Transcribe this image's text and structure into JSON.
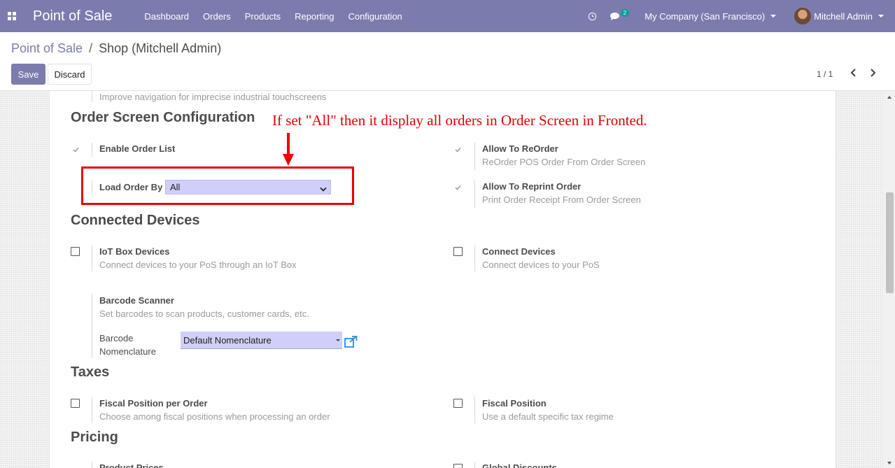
{
  "navbar": {
    "brand": "Point of Sale",
    "menu": [
      "Dashboard",
      "Orders",
      "Products",
      "Reporting",
      "Configuration"
    ],
    "chat_count": "2",
    "company": "My Company (San Francisco)",
    "user": "Mitchell Admin"
  },
  "breadcrumb": {
    "root": "Point of Sale",
    "separator": "/",
    "current": "Shop (Mitchell Admin)"
  },
  "buttons": {
    "save": "Save",
    "discard": "Discard"
  },
  "pager": {
    "value": "1 / 1"
  },
  "top_cut_help": "Improve navigation for imprecise industrial touchscreens",
  "sections": {
    "order_screen": {
      "title": "Order Screen Configuration",
      "enable_order_list": "Enable Order List",
      "load_order_by_label": "Load Order By",
      "load_order_by_value": "All",
      "allow_reorder": "Allow To ReOrder",
      "allow_reorder_help": "ReOrder POS Order From Order Screen",
      "allow_reprint": "Allow To Reprint Order",
      "allow_reprint_help": "Print Order Receipt From Order Screen"
    },
    "connected_devices": {
      "title": "Connected Devices",
      "iot_box": "IoT Box Devices",
      "iot_box_help": "Connect devices to your PoS through an IoT Box",
      "connect_devices": "Connect Devices",
      "connect_devices_help": "Connect devices to your PoS",
      "barcode_scanner": "Barcode Scanner",
      "barcode_scanner_help": "Set barcodes to scan products, customer cards, etc.",
      "barcode_nomenclature_label_1": "Barcode",
      "barcode_nomenclature_label_2": "Nomenclature",
      "barcode_nomenclature_value": "Default Nomenclature"
    },
    "taxes": {
      "title": "Taxes",
      "fiscal_position_per_order": "Fiscal Position per Order",
      "fiscal_position_per_order_help": "Choose among fiscal positions when processing an order",
      "fiscal_position": "Fiscal Position",
      "fiscal_position_help": "Use a default specific tax regime"
    },
    "pricing": {
      "title": "Pricing",
      "product_prices": "Product Prices",
      "global_discounts": "Global Discounts"
    }
  },
  "annotation": {
    "text": "If set \"All\" then it display all orders in Order Screen in Fronted.",
    "color": "#e00000"
  },
  "colors": {
    "primary": "#7c7bad",
    "select_bg": "#cfcffa"
  }
}
